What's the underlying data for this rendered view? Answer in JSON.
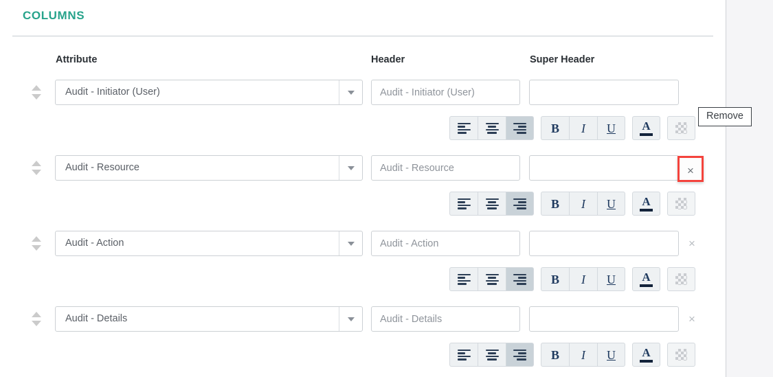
{
  "section": {
    "title": "COLUMNS"
  },
  "columns_header": {
    "attribute": "Attribute",
    "header": "Header",
    "super_header": "Super Header"
  },
  "tooltip": {
    "label": "Remove"
  },
  "toolbar": {
    "align_left_label": "Align left",
    "align_center_label": "Align center",
    "align_right_label": "Align right",
    "bold_label": "B",
    "italic_label": "I",
    "underline_label": "U",
    "font_color_label": "A",
    "background_color_label": "Background color"
  },
  "colors": {
    "accent_teal": "#27a38b",
    "highlight_red": "#f4433c",
    "field_border": "#ccd0d4",
    "toolbar_button_bg": "#eef1f3",
    "toolbar_active_bg": "#c9d2d8",
    "glyph_navy": "#1f3a5f",
    "side_panel_bg": "#f5f5f7"
  },
  "rows": [
    {
      "attribute_value": "Audit - Initiator (User)",
      "header_value": "",
      "header_placeholder": "Audit - Initiator (User)",
      "super_header_value": "",
      "super_header_placeholder": "",
      "remove_label": "×",
      "align": "right",
      "remove_highlighted": true
    },
    {
      "attribute_value": "Audit - Resource",
      "header_value": "",
      "header_placeholder": "Audit - Resource",
      "super_header_value": "",
      "super_header_placeholder": "",
      "remove_label": "×",
      "align": "right",
      "remove_highlighted": false
    },
    {
      "attribute_value": "Audit - Action",
      "header_value": "",
      "header_placeholder": "Audit - Action",
      "super_header_value": "",
      "super_header_placeholder": "",
      "remove_label": "×",
      "align": "right",
      "remove_highlighted": false
    },
    {
      "attribute_value": "Audit - Details",
      "header_value": "",
      "header_placeholder": "Audit - Details",
      "super_header_value": "",
      "super_header_placeholder": "",
      "remove_label": "×",
      "align": "right",
      "remove_highlighted": false
    }
  ]
}
